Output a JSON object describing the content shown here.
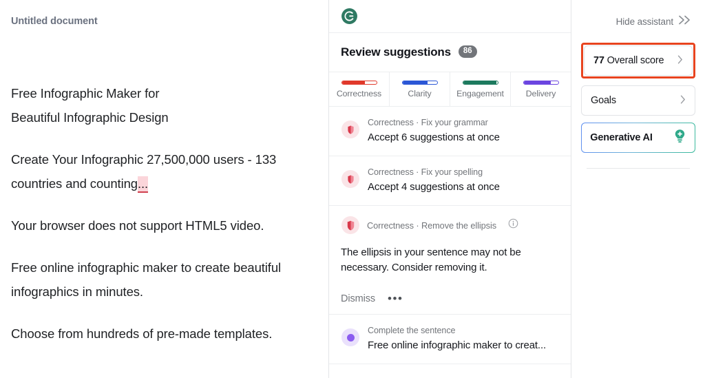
{
  "document": {
    "title": "Untitled document",
    "paragraphs": [
      {
        "id": "p1",
        "lines": [
          "Free Infographic Maker for",
          "Beautiful Infographic Design"
        ],
        "style": "plain"
      },
      {
        "id": "p2",
        "text_before": "Create Your Infographic 27,500,000 users - 133 countries and counting",
        "highlight": "...",
        "style": "highlighted"
      },
      {
        "id": "p3",
        "text": "Your browser does not support HTML5 video.",
        "style": "plain"
      },
      {
        "id": "p4",
        "text": "Free online infographic maker to create beautiful infographics in minutes.",
        "style": "purple-underline"
      },
      {
        "id": "p5",
        "text": "Choose from hundreds of pre-made templates.",
        "style": "plain"
      }
    ]
  },
  "assistant": {
    "logo_icon": "grammarly-g-logo-icon",
    "header_title": "Review suggestions",
    "header_count": "86",
    "tabs": [
      {
        "label": "Correctness",
        "color": "#e0392b",
        "fill_percent": 66
      },
      {
        "label": "Clarity",
        "color": "#2b57d6",
        "fill_percent": 73
      },
      {
        "label": "Engagement",
        "color": "#1d7a5e",
        "fill_percent": 97
      },
      {
        "label": "Delivery",
        "color": "#6b45e0",
        "fill_percent": 79
      }
    ],
    "suggestions": [
      {
        "type": "row",
        "icon": "correctness-shield-icon",
        "icon_color": "#d8384a",
        "glow_color": "rgba(228,120,136,0.22)",
        "category": "Correctness · Fix your grammar",
        "main": "Accept 6 suggestions at once"
      },
      {
        "type": "row",
        "icon": "correctness-shield-icon",
        "icon_color": "#d8384a",
        "glow_color": "rgba(228,120,136,0.22)",
        "category": "Correctness · Fix your spelling",
        "main": "Accept 4 suggestions at once"
      },
      {
        "type": "card",
        "icon": "correctness-shield-icon",
        "icon_color": "#d8384a",
        "glow_color": "rgba(228,120,136,0.22)",
        "category": "Correctness · Remove the ellipsis",
        "info_icon": "info-circle-icon",
        "body": "The ellipsis in your sentence may not be necessary. Consider removing it.",
        "dismiss_label": "Dismiss",
        "more_label": "•••"
      },
      {
        "type": "row",
        "icon": "engagement-dot-icon",
        "icon_color": "#8b5cf0",
        "glow_color": "rgba(160,120,240,0.22)",
        "category": "Complete the sentence",
        "main": "Free online infographic maker to creat..."
      }
    ]
  },
  "sidebar": {
    "hide_assistant_label": "Hide assistant",
    "hide_assistant_icon": "chevron-double-right-icon",
    "overall_score": {
      "value": "77",
      "label": "Overall score",
      "chevron_icon": "chevron-right-icon",
      "highlight_color": "#e8441f"
    },
    "goals": {
      "label": "Goals",
      "chevron_icon": "chevron-right-icon"
    },
    "generative_ai": {
      "label": "Generative AI",
      "icon": "lightbulb-plus-icon",
      "icon_color": "#2fa98a"
    }
  }
}
